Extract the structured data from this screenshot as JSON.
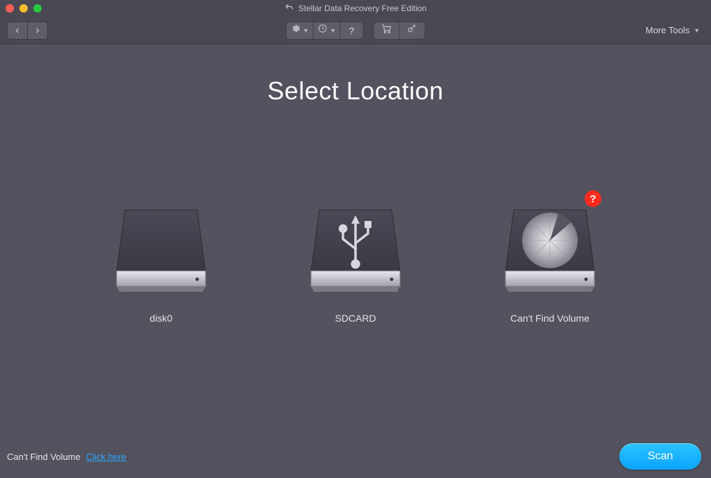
{
  "window": {
    "title": "Stellar Data Recovery Free Edition"
  },
  "toolbar": {
    "more_tools_label": "More Tools"
  },
  "page": {
    "title": "Select Location"
  },
  "drives": [
    {
      "label": "disk0"
    },
    {
      "label": "SDCARD"
    },
    {
      "label": "Can't Find Volume",
      "badge": "?"
    }
  ],
  "footer": {
    "hint_text": "Can't Find Volume",
    "link_text": "Click here",
    "scan_label": "Scan"
  }
}
